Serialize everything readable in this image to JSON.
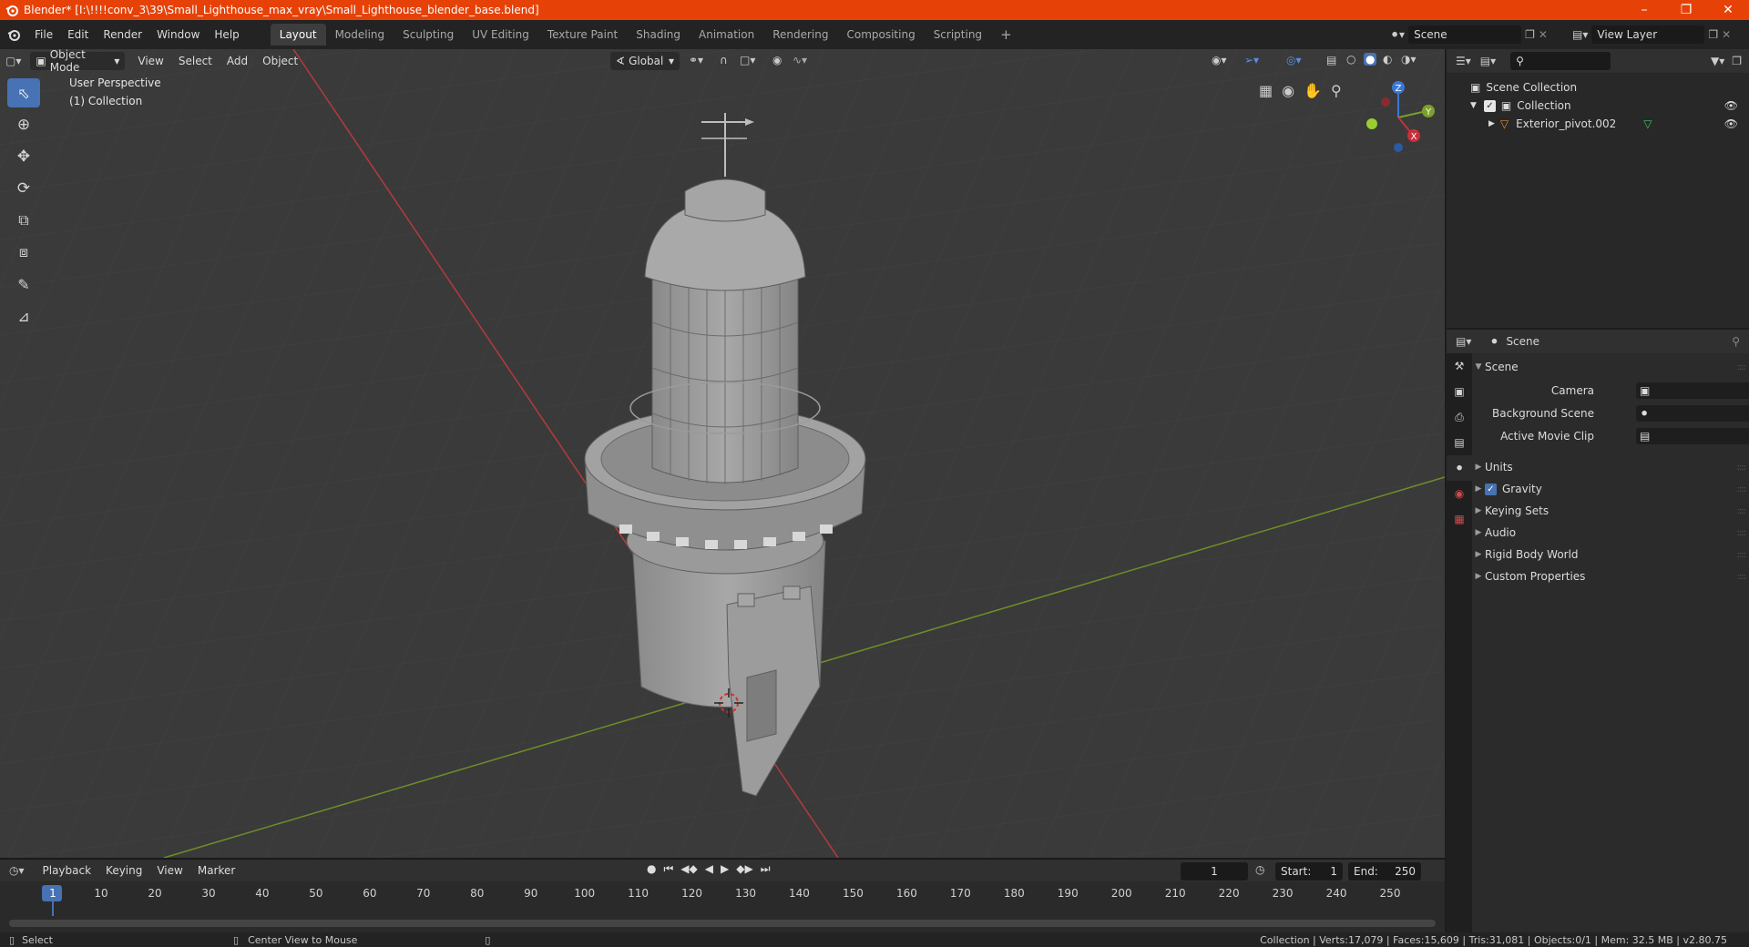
{
  "title": "Blender* [I:\\!!!!conv_3\\39\\Small_Lighthouse_max_vray\\Small_Lighthouse_blender_base.blend]",
  "menu": [
    "File",
    "Edit",
    "Render",
    "Window",
    "Help"
  ],
  "workspaces": [
    "Layout",
    "Modeling",
    "Sculpting",
    "UV Editing",
    "Texture Paint",
    "Shading",
    "Animation",
    "Rendering",
    "Compositing",
    "Scripting"
  ],
  "active_workspace": "Layout",
  "scene_name": "Scene",
  "view_layer": "View Layer",
  "viewport": {
    "mode": "Object Mode",
    "menus": [
      "View",
      "Select",
      "Add",
      "Object"
    ],
    "transform_orientation": "Global",
    "perspective_label": "User Perspective",
    "collection_label": "(1) Collection",
    "gizmo": {
      "z": "Z",
      "y": "Y",
      "x": "X"
    }
  },
  "outliner": {
    "root": "Scene Collection",
    "collection": "Collection",
    "object": "Exterior_pivot.002"
  },
  "properties": {
    "header": "Scene",
    "panel": "Scene",
    "camera_label": "Camera",
    "background_scene_label": "Background Scene",
    "active_movie_clip_label": "Active Movie Clip",
    "sections": [
      "Units",
      "Gravity",
      "Keying Sets",
      "Audio",
      "Rigid Body World",
      "Custom Properties"
    ],
    "gravity_checked": true
  },
  "timeline": {
    "menus": [
      "Playback",
      "Keying",
      "View",
      "Marker"
    ],
    "current_frame": "1",
    "start_label": "Start:",
    "start": "1",
    "end_label": "End:",
    "end": "250",
    "frames": [
      "1",
      "10",
      "20",
      "30",
      "40",
      "50",
      "60",
      "70",
      "80",
      "90",
      "100",
      "110",
      "120",
      "130",
      "140",
      "150",
      "160",
      "170",
      "180",
      "190",
      "200",
      "210",
      "220",
      "230",
      "240",
      "250"
    ]
  },
  "status": {
    "select": "Select",
    "center_view": "Center View to Mouse",
    "stats": "Collection | Verts:17,079 | Faces:15,609 | Tris:31,081 | Objects:0/1 | Mem: 32.5 MB | v2.80.75"
  },
  "colors": {
    "accent": "#4772b3",
    "titlebar": "#e64208",
    "x_axis": "#c8303a",
    "y_axis": "#7aa12a"
  }
}
